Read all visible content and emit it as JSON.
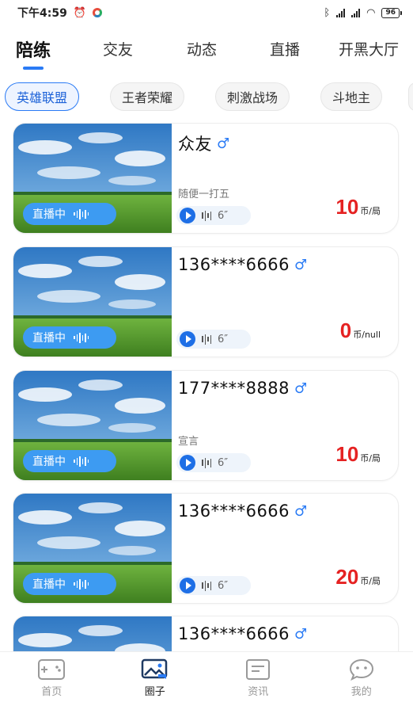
{
  "status_bar": {
    "time": "下午4:59",
    "battery": "96"
  },
  "top_tabs": [
    {
      "label": "陪练",
      "active": true
    },
    {
      "label": "交友",
      "active": false
    },
    {
      "label": "动态",
      "active": false
    },
    {
      "label": "直播",
      "active": false
    },
    {
      "label": "开黑大厅",
      "active": false
    }
  ],
  "game_chips": [
    {
      "label": "英雄联盟",
      "active": true
    },
    {
      "label": "王者荣耀",
      "active": false
    },
    {
      "label": "刺激战场",
      "active": false
    },
    {
      "label": "斗地主",
      "active": false
    }
  ],
  "cards": [
    {
      "name": "众友",
      "gender": "♂",
      "desc": "随便一打五",
      "live": "直播中",
      "voice_duration": "6″",
      "price": "10",
      "price_unit": "币/局"
    },
    {
      "name": "136****6666",
      "gender": "♂",
      "desc": "",
      "live": "直播中",
      "voice_duration": "6″",
      "price": "0",
      "price_unit": "币/null"
    },
    {
      "name": "177****8888",
      "gender": "♂",
      "desc": "宣言",
      "live": "直播中",
      "voice_duration": "6″",
      "price": "10",
      "price_unit": "币/局"
    },
    {
      "name": "136****6666",
      "gender": "♂",
      "desc": "",
      "live": "直播中",
      "voice_duration": "6″",
      "price": "20",
      "price_unit": "币/局"
    },
    {
      "name": "136****6666",
      "gender": "♂",
      "desc": "",
      "live": "直播中",
      "voice_duration": "6″",
      "price": "",
      "price_unit": ""
    }
  ],
  "bottom_nav": [
    {
      "label": "首页",
      "icon": "gamepad-icon",
      "active": false
    },
    {
      "label": "圈子",
      "icon": "image-chat-icon",
      "active": true
    },
    {
      "label": "资讯",
      "icon": "news-icon",
      "active": false
    },
    {
      "label": "我的",
      "icon": "chat-face-icon",
      "active": false
    }
  ],
  "colors": {
    "accent": "#2a7bf5",
    "live_pill": "#3d9bf2",
    "price": "#e52222"
  }
}
